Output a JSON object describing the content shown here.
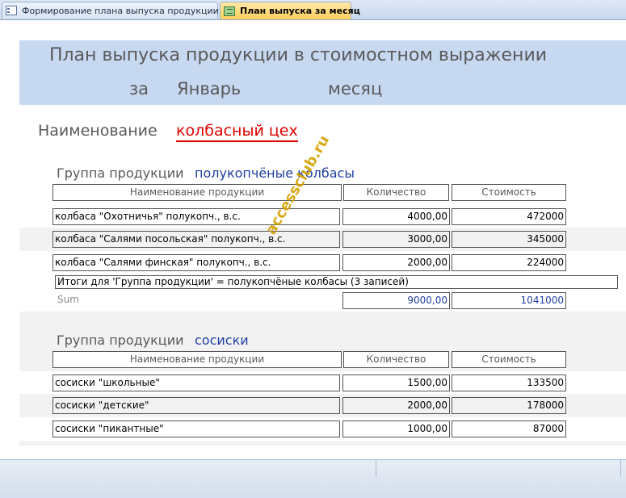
{
  "tabs": [
    {
      "label": "Формирование плана выпуска продукции",
      "icon": "form-icon",
      "active": false
    },
    {
      "label": "План выпуска за месяц",
      "icon": "report-icon",
      "active": true
    }
  ],
  "report": {
    "title": "План выпуска продукции в стоимостном выражении",
    "za": "за",
    "month": "Январь",
    "mes": "месяц",
    "name_label": "Наименование",
    "workshop": "колбасный цех",
    "watermark": "accessclub.ru"
  },
  "columns": {
    "name": "Наименование продукции",
    "qty": "Количество",
    "cost": "Стоимость"
  },
  "groups": [
    {
      "label": "Группа продукции",
      "value": "полукопчёные колбасы",
      "rows": [
        {
          "name": "колбаса \"Охотничья\" полукопч., в.с.",
          "qty": "4000,00",
          "cost": "472000"
        },
        {
          "name": "колбаса \"Салями посольская\" полукопч., в.с.",
          "qty": "3000,00",
          "cost": "345000"
        },
        {
          "name": "колбаса \"Салями финская\" полукопч., в.с.",
          "qty": "2000,00",
          "cost": "224000"
        }
      ],
      "totals_text": "Итоги для 'Группа продукции' =  полукопчёные колбасы (3 записей)",
      "sum_label": "Sum",
      "sum_qty": "9000,00",
      "sum_cost": "1041000"
    },
    {
      "label": "Группа продукции",
      "value": "сосиски",
      "rows": [
        {
          "name": "сосиски \"школьные\"",
          "qty": "1500,00",
          "cost": "133500"
        },
        {
          "name": "сосиски \"детские\"",
          "qty": "2000,00",
          "cost": "178000"
        },
        {
          "name": "сосиски \"пикантные\"",
          "qty": "1000,00",
          "cost": "87000"
        }
      ]
    }
  ],
  "colors": {
    "header_band": "#c6d9f1",
    "workshop_red": "#e00000",
    "group_value_blue": "#1f3fa0",
    "active_tab": "#ffcf5c",
    "stripe": "#f2f2f2"
  }
}
